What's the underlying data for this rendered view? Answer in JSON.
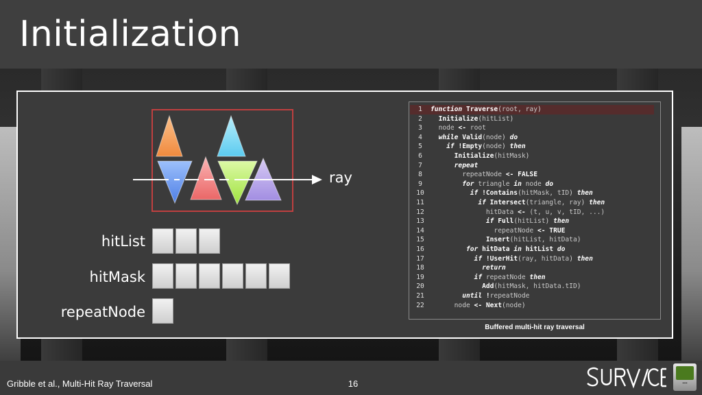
{
  "slide": {
    "title": "Initialization",
    "page_number": "16",
    "footer_text": "Gribble et al., Multi-Hit Ray Traversal"
  },
  "diagram": {
    "ray_label": "ray",
    "labels": {
      "hitList": "hitList",
      "hitMask": "hitMask",
      "repeatNode": "repeatNode"
    },
    "cell_counts": {
      "hitList": 3,
      "hitMask": 6,
      "repeatNode": 1
    },
    "triangle_colors": {
      "orange": "#f5a05a",
      "cyan": "#7fd8f2",
      "blue": "#6c9bf0",
      "red": "#f07d7d",
      "green": "#b7ef63",
      "purple": "#b9a6ea"
    },
    "box_color": "#c04040"
  },
  "code": {
    "caption": "Buffered multi-hit ray traversal",
    "highlight_color": "#552c2c",
    "lines": [
      {
        "n": "1",
        "segs": [
          [
            "k",
            "function "
          ],
          [
            "f",
            "Traverse"
          ],
          [
            "t",
            "("
          ],
          [
            "v",
            "root, ray"
          ],
          [
            "t",
            ")"
          ]
        ]
      },
      {
        "n": "2",
        "segs": [
          [
            "t",
            "  "
          ],
          [
            "f",
            "Initialize"
          ],
          [
            "t",
            "("
          ],
          [
            "v",
            "hitList"
          ],
          [
            "t",
            ")"
          ]
        ]
      },
      {
        "n": "3",
        "segs": [
          [
            "t",
            "  "
          ],
          [
            "v",
            "node "
          ],
          [
            "o",
            "<-"
          ],
          [
            "v",
            " root"
          ]
        ]
      },
      {
        "n": "4",
        "segs": [
          [
            "t",
            "  "
          ],
          [
            "k",
            "while "
          ],
          [
            "f",
            "Valid"
          ],
          [
            "t",
            "("
          ],
          [
            "v",
            "node"
          ],
          [
            "t",
            ") "
          ],
          [
            "k",
            "do"
          ]
        ]
      },
      {
        "n": "5",
        "segs": [
          [
            "t",
            "    "
          ],
          [
            "k",
            "if "
          ],
          [
            "f",
            "!Empty"
          ],
          [
            "t",
            "("
          ],
          [
            "v",
            "node"
          ],
          [
            "t",
            ") "
          ],
          [
            "k",
            "then"
          ]
        ]
      },
      {
        "n": "6",
        "segs": [
          [
            "t",
            "      "
          ],
          [
            "f",
            "Initialize"
          ],
          [
            "t",
            "("
          ],
          [
            "v",
            "hitMask"
          ],
          [
            "t",
            ")"
          ]
        ]
      },
      {
        "n": "7",
        "segs": [
          [
            "t",
            "      "
          ],
          [
            "k",
            "repeat"
          ]
        ]
      },
      {
        "n": "8",
        "segs": [
          [
            "t",
            "        "
          ],
          [
            "v",
            "repeatNode "
          ],
          [
            "o",
            "<- FALSE"
          ]
        ]
      },
      {
        "n": "9",
        "segs": [
          [
            "t",
            "        "
          ],
          [
            "k",
            "for "
          ],
          [
            "v",
            "triangle "
          ],
          [
            "k",
            "in "
          ],
          [
            "v",
            "node "
          ],
          [
            "k",
            "do"
          ]
        ]
      },
      {
        "n": "10",
        "segs": [
          [
            "t",
            "          "
          ],
          [
            "k",
            "if "
          ],
          [
            "f",
            "!Contains"
          ],
          [
            "t",
            "("
          ],
          [
            "v",
            "hitMask, tID"
          ],
          [
            "t",
            ") "
          ],
          [
            "k",
            "then"
          ]
        ]
      },
      {
        "n": "11",
        "segs": [
          [
            "t",
            "            "
          ],
          [
            "k",
            "if "
          ],
          [
            "f",
            "Intersect"
          ],
          [
            "t",
            "("
          ],
          [
            "v",
            "triangle, ray"
          ],
          [
            "t",
            ") "
          ],
          [
            "k",
            "then"
          ]
        ]
      },
      {
        "n": "12",
        "segs": [
          [
            "t",
            "              "
          ],
          [
            "v",
            "hitData "
          ],
          [
            "o",
            "<-"
          ],
          [
            "v",
            " (t, u, v, tID, ...)"
          ]
        ]
      },
      {
        "n": "13",
        "segs": [
          [
            "t",
            "              "
          ],
          [
            "k",
            "if "
          ],
          [
            "f",
            "Full"
          ],
          [
            "t",
            "("
          ],
          [
            "v",
            "hitList"
          ],
          [
            "t",
            ") "
          ],
          [
            "k",
            "then"
          ]
        ]
      },
      {
        "n": "14",
        "segs": [
          [
            "t",
            "                "
          ],
          [
            "v",
            "repeatNode "
          ],
          [
            "o",
            "<- TRUE"
          ]
        ]
      },
      {
        "n": "15",
        "segs": [
          [
            "t",
            "              "
          ],
          [
            "f",
            "Insert"
          ],
          [
            "t",
            "("
          ],
          [
            "v",
            "hitList, hitData"
          ],
          [
            "t",
            ")"
          ]
        ]
      },
      {
        "n": "16",
        "segs": [
          [
            "t",
            "         "
          ],
          [
            "k",
            "for "
          ],
          [
            "f",
            "hitData "
          ],
          [
            "k",
            "in "
          ],
          [
            "f",
            "hitList "
          ],
          [
            "k",
            "do"
          ]
        ]
      },
      {
        "n": "17",
        "segs": [
          [
            "t",
            "           "
          ],
          [
            "k",
            "if "
          ],
          [
            "f",
            "!UserHit"
          ],
          [
            "t",
            "("
          ],
          [
            "v",
            "ray, hitData"
          ],
          [
            "t",
            ") "
          ],
          [
            "k",
            "then"
          ]
        ]
      },
      {
        "n": "18",
        "segs": [
          [
            "t",
            "             "
          ],
          [
            "k",
            "return"
          ]
        ]
      },
      {
        "n": "19",
        "segs": [
          [
            "t",
            "           "
          ],
          [
            "k",
            "if "
          ],
          [
            "v",
            "repeatNode "
          ],
          [
            "k",
            "then"
          ]
        ]
      },
      {
        "n": "20",
        "segs": [
          [
            "t",
            "             "
          ],
          [
            "f",
            "Add"
          ],
          [
            "t",
            "("
          ],
          [
            "v",
            "hitMask, hitData.tID"
          ],
          [
            "t",
            ")"
          ]
        ]
      },
      {
        "n": "21",
        "segs": [
          [
            "t",
            "        "
          ],
          [
            "k",
            "until "
          ],
          [
            "f",
            "!"
          ],
          [
            "v",
            "repeatNode"
          ]
        ]
      },
      {
        "n": "22",
        "segs": [
          [
            "t",
            "      "
          ],
          [
            "v",
            "node "
          ],
          [
            "o",
            "<-"
          ],
          [
            "t",
            " "
          ],
          [
            "f",
            "Next"
          ],
          [
            "t",
            "("
          ],
          [
            "v",
            "node"
          ],
          [
            "t",
            ")"
          ]
        ]
      }
    ]
  }
}
